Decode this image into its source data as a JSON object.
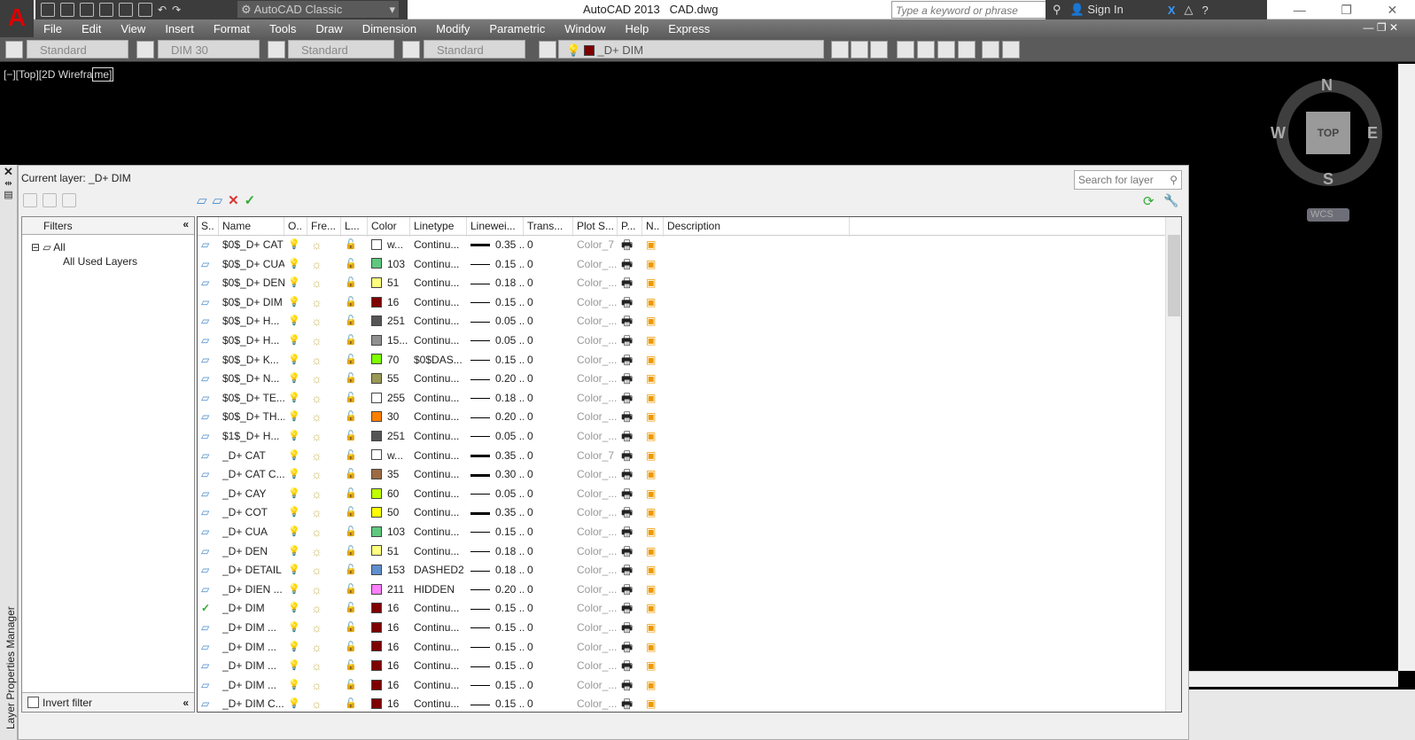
{
  "app": {
    "title": "AutoCAD 2013",
    "file": "CAD.dwg",
    "workspace": "AutoCAD Classic",
    "search_placeholder": "Type a keyword or phrase",
    "sign_in": "Sign In",
    "logo": "A"
  },
  "menu": [
    "File",
    "Edit",
    "View",
    "Insert",
    "Format",
    "Tools",
    "Draw",
    "Dimension",
    "Modify",
    "Parametric",
    "Window",
    "Help",
    "Express"
  ],
  "toolbar": {
    "text_style": "Standard",
    "dim_style": "DIM 30",
    "table_style": "Standard",
    "mleader_style": "Standard",
    "layer": "_D+ DIM",
    "layer_color": "#7f0000"
  },
  "viewport": {
    "label_prefix": "[−][Top][2D Wirefra",
    "label_box": "me]",
    "viewcube": {
      "n": "N",
      "s": "S",
      "e": "E",
      "w": "W",
      "face": "TOP",
      "wcs": "WCS"
    }
  },
  "layer_manager": {
    "side_title": "Layer Properties Manager",
    "current_layer": "Current layer: _D+ DIM",
    "search_placeholder": "Search for layer",
    "filters_label": "Filters",
    "tree": [
      "All",
      "All Used Layers"
    ],
    "invert_filter": "Invert filter",
    "columns": [
      "S..",
      "Name",
      "O..",
      "Fre...",
      "L...",
      "Color",
      "Linetype",
      "Linewei...",
      "Trans...",
      "Plot S...",
      "P...",
      "N..",
      "Description"
    ],
    "rows": [
      {
        "name": "$0$_D+ CAT",
        "color": "w...",
        "hex": "#ffffff",
        "linetype": "Continu...",
        "lw": "0.35 ...",
        "thick": true,
        "trans": "0",
        "plot": "Color_7"
      },
      {
        "name": "$0$_D+ CUA",
        "color": "103",
        "hex": "#5fc87f",
        "linetype": "Continu...",
        "lw": "0.15 ...",
        "trans": "0",
        "plot": "Color_..."
      },
      {
        "name": "$0$_D+ DEN",
        "color": "51",
        "hex": "#ffff7f",
        "linetype": "Continu...",
        "lw": "0.18 ...",
        "trans": "0",
        "plot": "Color_..."
      },
      {
        "name": "$0$_D+ DIM",
        "color": "16",
        "hex": "#7f0000",
        "linetype": "Continu...",
        "lw": "0.15 ...",
        "trans": "0",
        "plot": "Color_..."
      },
      {
        "name": "$0$_D+ H...",
        "color": "251",
        "hex": "#555555",
        "linetype": "Continu...",
        "lw": "0.05 ...",
        "trans": "0",
        "plot": "Color_..."
      },
      {
        "name": "$0$_D+ H...",
        "color": "15...",
        "hex": "#909090",
        "linetype": "Continu...",
        "lw": "0.05 ...",
        "trans": "0",
        "plot": "Color_..."
      },
      {
        "name": "$0$_D+ K...",
        "color": "70",
        "hex": "#7fff00",
        "linetype": "$0$DAS...",
        "lw": "0.15 ...",
        "trans": "0",
        "plot": "Color_..."
      },
      {
        "name": "$0$_D+ N...",
        "color": "55",
        "hex": "#999955",
        "linetype": "Continu...",
        "lw": "0.20 ...",
        "trans": "0",
        "plot": "Color_..."
      },
      {
        "name": "$0$_D+ TE...",
        "color": "255",
        "hex": "#ffffff",
        "linetype": "Continu...",
        "lw": "0.18 ...",
        "trans": "0",
        "plot": "Color_..."
      },
      {
        "name": "$0$_D+ TH...",
        "color": "30",
        "hex": "#ff7f00",
        "linetype": "Continu...",
        "lw": "0.20 ...",
        "trans": "0",
        "plot": "Color_..."
      },
      {
        "name": "$1$_D+ H...",
        "color": "251",
        "hex": "#555555",
        "linetype": "Continu...",
        "lw": "0.05 ...",
        "trans": "0",
        "plot": "Color_..."
      },
      {
        "name": "_D+ CAT",
        "color": "w...",
        "hex": "#ffffff",
        "linetype": "Continu...",
        "lw": "0.35 ...",
        "thick": true,
        "trans": "0",
        "plot": "Color_7"
      },
      {
        "name": "_D+ CAT C...",
        "color": "35",
        "hex": "#9c6b45",
        "linetype": "Continu...",
        "lw": "0.30 ...",
        "thick": true,
        "trans": "0",
        "plot": "Color_..."
      },
      {
        "name": "_D+ CAY",
        "color": "60",
        "hex": "#bfff00",
        "linetype": "Continu...",
        "lw": "0.05 ...",
        "trans": "0",
        "plot": "Color_..."
      },
      {
        "name": "_D+ COT",
        "color": "50",
        "hex": "#ffff00",
        "linetype": "Continu...",
        "lw": "0.35 ...",
        "thick": true,
        "trans": "0",
        "plot": "Color_..."
      },
      {
        "name": "_D+ CUA",
        "color": "103",
        "hex": "#5fc87f",
        "linetype": "Continu...",
        "lw": "0.15 ...",
        "trans": "0",
        "plot": "Color_..."
      },
      {
        "name": "_D+ DEN",
        "color": "51",
        "hex": "#ffff7f",
        "linetype": "Continu...",
        "lw": "0.18 ...",
        "trans": "0",
        "plot": "Color_..."
      },
      {
        "name": "_D+ DETAIL",
        "color": "153",
        "hex": "#5f8fcf",
        "linetype": "DASHED2",
        "lw": "0.18 ...",
        "trans": "0",
        "plot": "Color_..."
      },
      {
        "name": "_D+ DIEN ...",
        "color": "211",
        "hex": "#ff7fff",
        "linetype": "HIDDEN",
        "lw": "0.20 ...",
        "trans": "0",
        "plot": "Color_..."
      },
      {
        "name": "_D+ DIM",
        "color": "16",
        "hex": "#7f0000",
        "linetype": "Continu...",
        "lw": "0.15 ...",
        "trans": "0",
        "plot": "Color_...",
        "current": true
      },
      {
        "name": "_D+ DIM ...",
        "color": "16",
        "hex": "#7f0000",
        "linetype": "Continu...",
        "lw": "0.15 ...",
        "trans": "0",
        "plot": "Color_..."
      },
      {
        "name": "_D+ DIM ...",
        "color": "16",
        "hex": "#7f0000",
        "linetype": "Continu...",
        "lw": "0.15 ...",
        "trans": "0",
        "plot": "Color_..."
      },
      {
        "name": "_D+ DIM ...",
        "color": "16",
        "hex": "#7f0000",
        "linetype": "Continu...",
        "lw": "0.15 ...",
        "trans": "0",
        "plot": "Color_..."
      },
      {
        "name": "_D+ DIM ...",
        "color": "16",
        "hex": "#7f0000",
        "linetype": "Continu...",
        "lw": "0.15 ...",
        "trans": "0",
        "plot": "Color_..."
      },
      {
        "name": "_D+ DIM C...",
        "color": "16",
        "hex": "#7f0000",
        "linetype": "Continu...",
        "lw": "0.15 ...",
        "trans": "0",
        "plot": "Color_..."
      }
    ]
  }
}
